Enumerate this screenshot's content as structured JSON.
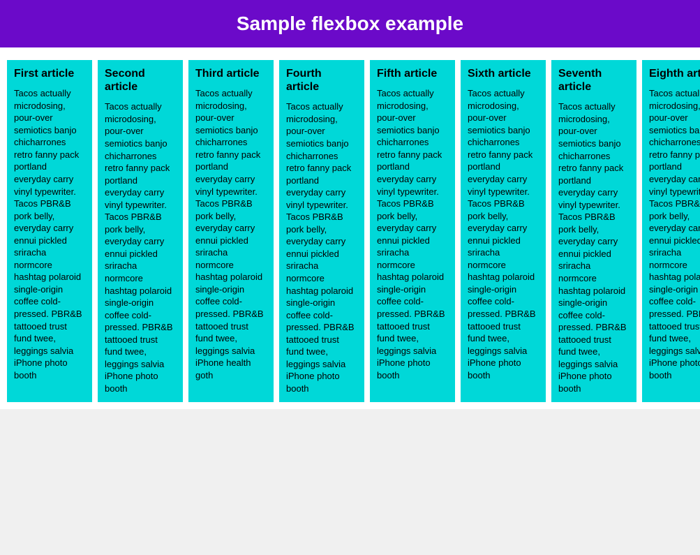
{
  "header": {
    "title": "Sample flexbox example"
  },
  "articles": [
    {
      "id": "first",
      "title": "First article",
      "body": "Tacos actually microdosing, pour-over semiotics banjo chicharrones retro fanny pack portland everyday carry vinyl typewriter. Tacos PBR&B pork belly, everyday carry ennui pickled sriracha normcore hashtag polaroid single-origin coffee cold-pressed. PBR&B tattooed trust fund twee, leggings salvia iPhone photo booth"
    },
    {
      "id": "second",
      "title": "Second article",
      "body": "Tacos actually microdosing, pour-over semiotics banjo chicharrones retro fanny pack portland everyday carry vinyl typewriter. Tacos PBR&B pork belly, everyday carry ennui pickled sriracha normcore hashtag polaroid single-origin coffee cold-pressed. PBR&B tattooed trust fund twee, leggings salvia iPhone photo booth"
    },
    {
      "id": "third",
      "title": "Third article",
      "body": "Tacos actually microdosing, pour-over semiotics banjo chicharrones retro fanny pack portland everyday carry vinyl typewriter. Tacos PBR&B pork belly, everyday carry ennui pickled sriracha normcore hashtag polaroid single-origin coffee cold-pressed. PBR&B tattooed trust fund twee, leggings salvia iPhone health goth"
    },
    {
      "id": "fourth",
      "title": "Fourth article",
      "body": "Tacos actually microdosing, pour-over semiotics banjo chicharrones retro fanny pack portland everyday carry vinyl typewriter. Tacos PBR&B pork belly, everyday carry ennui pickled sriracha normcore hashtag polaroid single-origin coffee cold-pressed. PBR&B tattooed trust fund twee, leggings salvia iPhone photo booth"
    },
    {
      "id": "fifth",
      "title": "Fifth article",
      "body": "Tacos actually microdosing, pour-over semiotics banjo chicharrones retro fanny pack portland everyday carry vinyl typewriter. Tacos PBR&B pork belly, everyday carry ennui pickled sriracha normcore hashtag polaroid single-origin coffee cold-pressed. PBR&B tattooed trust fund twee, leggings salvia iPhone photo booth"
    },
    {
      "id": "sixth",
      "title": "Sixth article",
      "body": "Tacos actually microdosing, pour-over semiotics banjo chicharrones retro fanny pack portland everyday carry vinyl typewriter. Tacos PBR&B pork belly, everyday carry ennui pickled sriracha normcore hashtag polaroid single-origin coffee cold-pressed. PBR&B tattooed trust fund twee, leggings salvia iPhone photo booth"
    },
    {
      "id": "seventh",
      "title": "Seventh article",
      "body": "Tacos actually microdosing, pour-over semiotics banjo chicharrones retro fanny pack portland everyday carry vinyl typewriter. Tacos PBR&B pork belly, everyday carry ennui pickled sriracha normcore hashtag polaroid single-origin coffee cold-pressed. PBR&B tattooed trust fund twee, leggings salvia iPhone photo booth"
    },
    {
      "id": "eighth",
      "title": "Eighth article",
      "body": "Tacos actually microdosing, pour-over semiotics banjo chicharrones retro fanny pack portland everyday carry vinyl typewriter. Tacos PBR&B pork belly, everyday carry ennui pickled sriracha normcore hashtag polaroid single-origin coffee cold-pressed. PBR&B tattooed trust fund twee, leggings salvia iPhone photo booth"
    }
  ],
  "colors": {
    "header_bg": "#6b0ac9",
    "card_bg": "#00d8d8",
    "header_text": "#ffffff"
  }
}
